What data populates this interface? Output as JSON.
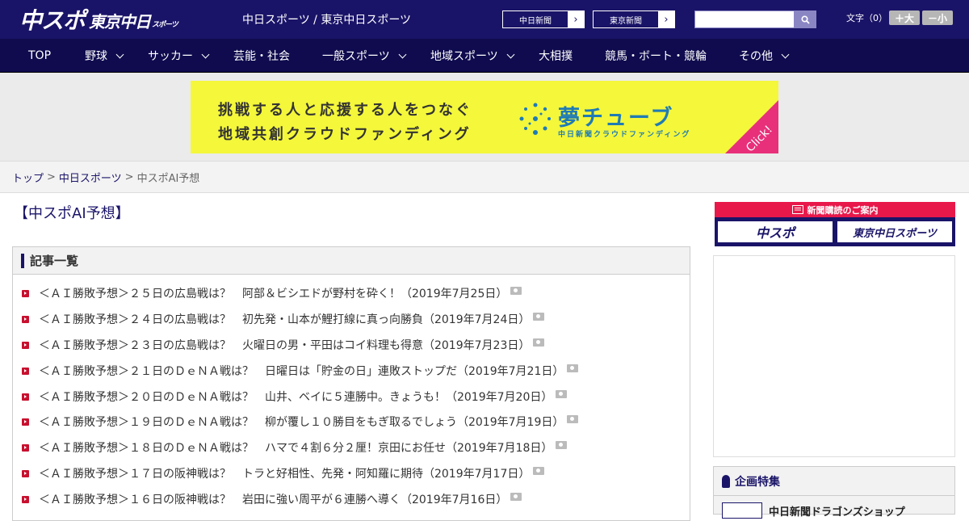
{
  "header": {
    "logo_chuspo": "中スポ",
    "logo_tokyo": "東京中日",
    "logo_tokyo_small": "スポーツ",
    "site_title": "中日スポーツ / 東京中日スポーツ",
    "ext_links": [
      {
        "label": "中日新聞",
        "arrow": "›"
      },
      {
        "label": "東京新聞",
        "arrow": "›"
      }
    ],
    "search_placeholder": "",
    "font_size_label": "文字（0）",
    "font_bigger": "＋大",
    "font_smaller": "－小"
  },
  "nav": {
    "items": [
      {
        "label": "TOP"
      },
      {
        "label": "野球"
      },
      {
        "label": "サッカー"
      },
      {
        "label": "芸能・社会"
      },
      {
        "label": "一般スポーツ"
      },
      {
        "label": "地域スポーツ"
      },
      {
        "label": "大相撲"
      },
      {
        "label": "競馬・ボート・競輪"
      },
      {
        "label": "その他"
      }
    ]
  },
  "banner": {
    "line1": "挑戦する人と応援する人をつなぐ",
    "line2": "地域共創クラウドファンディング",
    "brand": "夢チューブ",
    "brand_sub": "中日新聞クラウドファンディング",
    "click": "Click!",
    "colors": {
      "bg": "#f4f73a",
      "brand": "#1f7bb5",
      "corner": "#e8307a"
    }
  },
  "breadcrumb": {
    "home": "トップ",
    "section": "中日スポーツ",
    "current": "中スポAI予想",
    "sep": ">"
  },
  "page_title": "【中スポAI予想】",
  "article_list": {
    "heading": "記事一覧",
    "items": [
      "＜ＡＩ勝敗予想＞２５日の広島戦は？　阿部＆ビシエドが野村を砕く！（2019年7月25日）",
      "＜ＡＩ勝敗予想＞２４日の広島戦は？　初先発・山本が鯉打線に真っ向勝負（2019年7月24日）",
      "＜ＡＩ勝敗予想＞２３日の広島戦は？　火曜日の男・平田はコイ料理も得意（2019年7月23日）",
      "＜ＡＩ勝敗予想＞２１日のＤｅＮＡ戦は？　日曜日は「貯金の日」連敗ストップだ（2019年7月21日）",
      "＜ＡＩ勝敗予想＞２０日のＤｅＮＡ戦は？　山井、ベイに５連勝中。きょうも！（2019年7月20日）",
      "＜ＡＩ勝敗予想＞１９日のＤｅＮＡ戦は？　柳が覆し１０勝目をもぎ取るでしょう（2019年7月19日）",
      "＜ＡＩ勝敗予想＞１８日のＤｅＮＡ戦は？　ハマで４割６分２厘！京田にお任せ（2019年7月18日）",
      "＜ＡＩ勝敗予想＞１７日の阪神戦は？　トラと好相性、先発・阿知羅に期待（2019年7月17日）",
      "＜ＡＩ勝敗予想＞１６日の阪神戦は？　岩田に強い周平が６連勝へ導く（2019年7月16日）"
    ]
  },
  "sidebar": {
    "subscribe_heading": "新聞購読のご案内",
    "subscribe_logos": [
      "中スポ",
      "東京中日スポーツ"
    ],
    "feature_heading": "企画特集",
    "feature_item": "中日新聞ドラゴンズショップ"
  },
  "colors": {
    "navy": "#1a1468",
    "nav": "#0f0b4e",
    "red": "#c8102e",
    "pink": "#e8184a"
  }
}
